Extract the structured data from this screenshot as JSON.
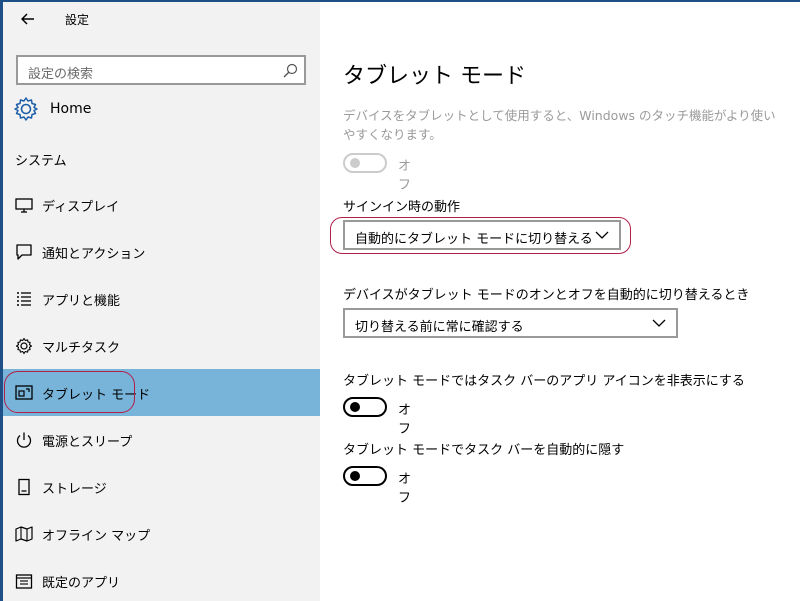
{
  "app": {
    "title": "設定"
  },
  "search": {
    "placeholder": "設定の検索"
  },
  "home": {
    "label": "Home"
  },
  "sidebar": {
    "section": "システム",
    "items": [
      {
        "label": "ディスプレイ",
        "icon": "monitor-icon"
      },
      {
        "label": "通知とアクション",
        "icon": "message-icon"
      },
      {
        "label": "アプリと機能",
        "icon": "list-icon"
      },
      {
        "label": "マルチタスク",
        "icon": "gear-icon"
      },
      {
        "label": "タブレット モード",
        "icon": "tablet-mode-icon",
        "selected": true
      },
      {
        "label": "電源とスリープ",
        "icon": "power-icon"
      },
      {
        "label": "ストレージ",
        "icon": "storage-icon"
      },
      {
        "label": "オフライン マップ",
        "icon": "map-icon"
      },
      {
        "label": "既定のアプリ",
        "icon": "default-apps-icon"
      }
    ],
    "selected_color": "#78b4d9"
  },
  "main": {
    "title": "タブレット モード",
    "description": "デバイスをタブレットとして使用すると、Windows のタッチ機能がより使いやすくなります。",
    "tablet_toggle": {
      "state": "off",
      "label": "オフ",
      "disabled": true
    },
    "signin": {
      "label": "サインイン時の動作",
      "value": "自動的にタブレット モードに切り替える"
    },
    "auto_switch": {
      "label": "デバイスがタブレット モードのオンとオフを自動的に切り替えるとき",
      "value": "切り替える前に常に確認する"
    },
    "hide_icons": {
      "label": "タブレット モードではタスク バーのアプリ アイコンを非表示にする",
      "toggle_label": "オフ"
    },
    "autohide_taskbar": {
      "label": "タブレット モードでタスク バーを自動的に隠す",
      "toggle_label": "オフ"
    }
  },
  "annotation_color": "#b2204a"
}
